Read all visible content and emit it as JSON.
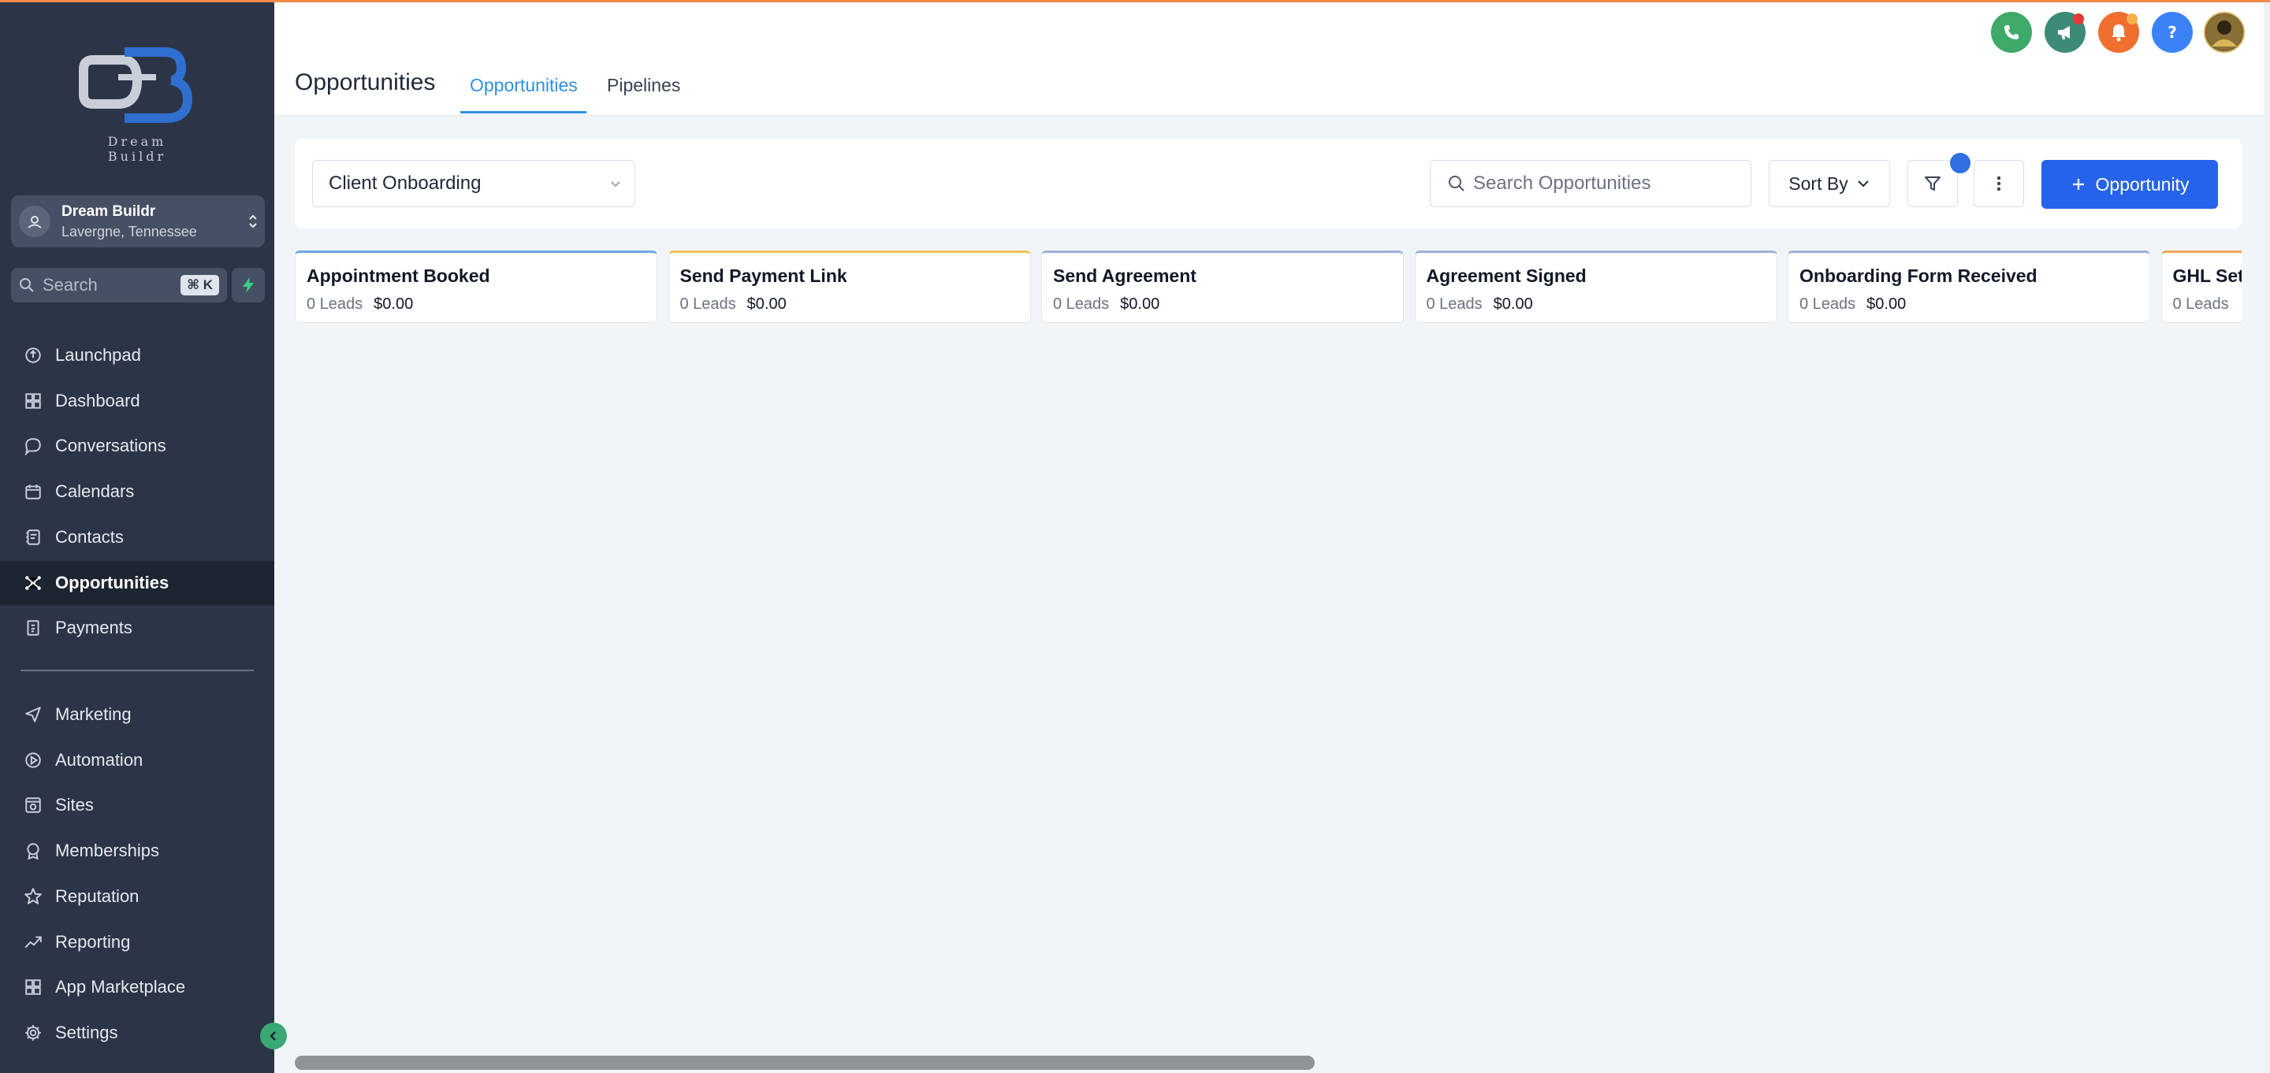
{
  "brand": {
    "logo_text": "Dream Buildr"
  },
  "account": {
    "name": "Dream Buildr",
    "location": "Lavergne, Tennessee"
  },
  "sidebar_search": {
    "label": "Search",
    "shortcut": "⌘ K"
  },
  "nav": {
    "primary": [
      {
        "label": "Launchpad",
        "icon": "launchpad-icon"
      },
      {
        "label": "Dashboard",
        "icon": "dashboard-icon"
      },
      {
        "label": "Conversations",
        "icon": "chat-bubble-icon"
      },
      {
        "label": "Calendars",
        "icon": "calendar-icon"
      },
      {
        "label": "Contacts",
        "icon": "contacts-icon"
      },
      {
        "label": "Opportunities",
        "icon": "opportunities-icon",
        "active": true
      },
      {
        "label": "Payments",
        "icon": "payments-icon"
      }
    ],
    "secondary": [
      {
        "label": "Marketing",
        "icon": "send-icon"
      },
      {
        "label": "Automation",
        "icon": "automation-icon"
      },
      {
        "label": "Sites",
        "icon": "sites-icon"
      },
      {
        "label": "Memberships",
        "icon": "badge-icon"
      },
      {
        "label": "Reputation",
        "icon": "star-icon"
      },
      {
        "label": "Reporting",
        "icon": "trend-icon"
      },
      {
        "label": "App Marketplace",
        "icon": "grid-icon"
      },
      {
        "label": "Settings",
        "icon": "gear-icon"
      }
    ]
  },
  "header": {
    "title": "Opportunities",
    "tabs": [
      {
        "label": "Opportunities",
        "active": true
      },
      {
        "label": "Pipelines",
        "active": false
      }
    ]
  },
  "toolbar": {
    "pipeline": "Client Onboarding",
    "search_placeholder": "Search Opportunities",
    "sort_label": "Sort By",
    "add_label": "Opportunity"
  },
  "stages": [
    {
      "name": "Appointment Booked",
      "leads": "0 Leads",
      "value": "$0.00",
      "color": "#6aa8e6"
    },
    {
      "name": "Send Payment Link",
      "leads": "0 Leads",
      "value": "$0.00",
      "color": "#f1c15a"
    },
    {
      "name": "Send Agreement",
      "leads": "0 Leads",
      "value": "$0.00",
      "color": "#9db2d8"
    },
    {
      "name": "Agreement Signed",
      "leads": "0 Leads",
      "value": "$0.00",
      "color": "#9db2d8"
    },
    {
      "name": "Onboarding Form Received",
      "leads": "0 Leads",
      "value": "$0.00",
      "color": "#9db2d8"
    },
    {
      "name": "GHL Set",
      "leads": "0 Leads",
      "value": "",
      "color": "#f0a657"
    }
  ],
  "colors": {
    "sidebar_bg": "#2c3547",
    "accent_blue": "#2563eb",
    "tab_active": "#2f8fe0",
    "phone": "#3fa96a",
    "announce": "#3e8a78",
    "bell": "#f06e2e",
    "help": "#3b82f6"
  },
  "scroll": {
    "position": 0
  }
}
